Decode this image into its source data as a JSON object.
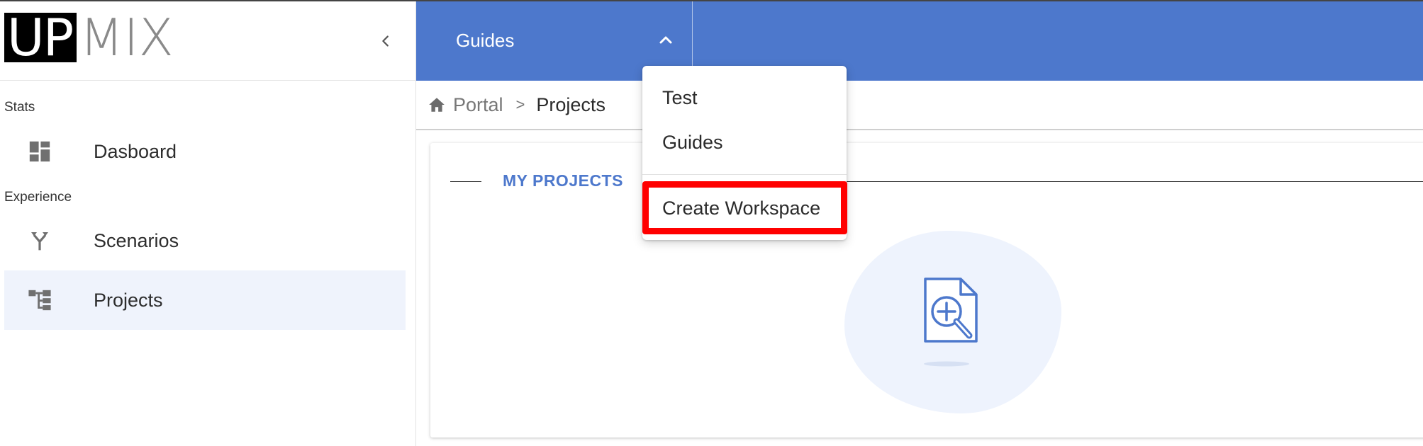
{
  "app": {
    "logo_left": "UP",
    "logo_right": "MIX"
  },
  "sidebar": {
    "sections": [
      {
        "label": "Stats"
      },
      {
        "label": "Experience"
      }
    ],
    "items": [
      {
        "label": "Dasboard",
        "icon": "dashboard-icon"
      },
      {
        "label": "Scenarios",
        "icon": "fork-icon"
      },
      {
        "label": "Projects",
        "icon": "hierarchy-icon",
        "active": true
      }
    ]
  },
  "topbar": {
    "workspace_select": "Guides"
  },
  "breadcrumb": {
    "items": [
      "Portal",
      "Projects"
    ],
    "separator": ">"
  },
  "main": {
    "card_title": "MY PROJECTS"
  },
  "workspace_menu": {
    "items": [
      "Test",
      "Guides"
    ],
    "action": "Create Workspace",
    "highlight_color": "#ff0000"
  },
  "colors": {
    "accent": "#4d78cc",
    "active_bg": "#eff3fc"
  }
}
